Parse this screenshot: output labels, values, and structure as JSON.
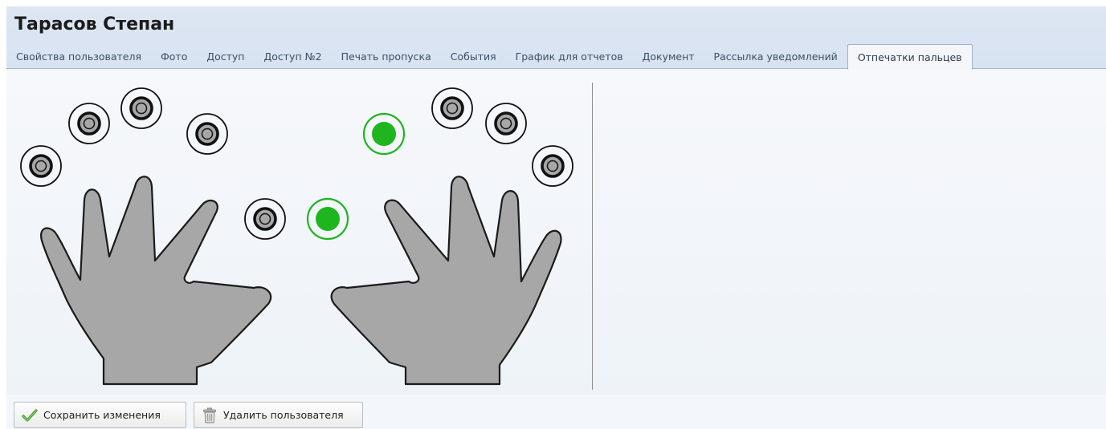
{
  "user": {
    "name": "Тарасов Степан"
  },
  "tabs": [
    {
      "label": "Свойства пользователя",
      "active": false
    },
    {
      "label": "Фото",
      "active": false
    },
    {
      "label": "Доступ",
      "active": false
    },
    {
      "label": "Доступ №2",
      "active": false
    },
    {
      "label": "Печать пропуска",
      "active": false
    },
    {
      "label": "События",
      "active": false
    },
    {
      "label": "График для отчетов",
      "active": false
    },
    {
      "label": "Документ",
      "active": false
    },
    {
      "label": "Рассылка уведомлений",
      "active": false
    },
    {
      "label": "Отпечатки пальцев",
      "active": true
    }
  ],
  "fingerprints": {
    "left_hand": [
      {
        "finger": "little",
        "enrolled": false
      },
      {
        "finger": "ring",
        "enrolled": false
      },
      {
        "finger": "middle",
        "enrolled": false
      },
      {
        "finger": "index",
        "enrolled": false
      },
      {
        "finger": "thumb",
        "enrolled": false
      }
    ],
    "right_hand": [
      {
        "finger": "thumb",
        "enrolled": true
      },
      {
        "finger": "index",
        "enrolled": true
      },
      {
        "finger": "middle",
        "enrolled": false
      },
      {
        "finger": "ring",
        "enrolled": false
      },
      {
        "finger": "little",
        "enrolled": false
      }
    ],
    "enrolled_color": "#1fb51f",
    "not_enrolled_color": "#111111",
    "hand_color": "#a8a7a7"
  },
  "buttons": {
    "save": {
      "label": "Сохранить изменения",
      "icon": "checkmark-icon"
    },
    "delete": {
      "label": "Удалить пользователя",
      "icon": "trash-icon"
    }
  },
  "colors": {
    "header_bg": "#dae4f2",
    "content_bg": "#f3f6fa",
    "tab_border": "#9db3d1"
  }
}
